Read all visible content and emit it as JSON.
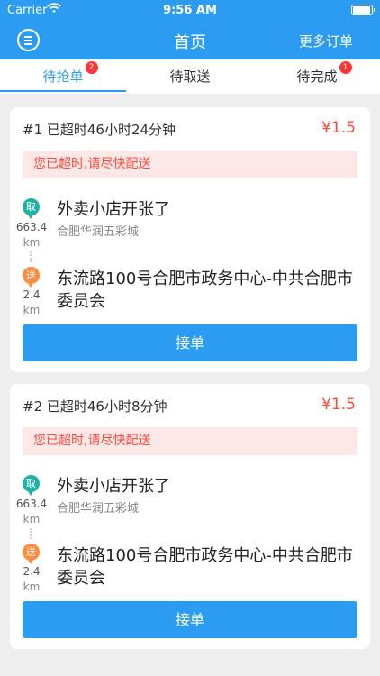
{
  "status_bar": {
    "carrier": "Carrier",
    "time": "9:56 AM"
  },
  "header": {
    "title": "首页",
    "more_orders": "更多订单"
  },
  "tabs": [
    {
      "label": "待抢单",
      "badge": "2",
      "active": true
    },
    {
      "label": "待取送",
      "badge": "",
      "active": false
    },
    {
      "label": "待完成",
      "badge": "1",
      "active": false
    }
  ],
  "orders": [
    {
      "header": "#1 已超时46小时24分钟",
      "price": "¥1.5",
      "alert": "您已超时,请尽快配送",
      "pickup_pin": "取",
      "pickup_distance": "663.4",
      "pickup_unit": "km",
      "shop_name": "外卖小店开张了",
      "shop_address": "合肥华润五彩城",
      "drop_pin": "送",
      "drop_distance": "2.4",
      "drop_unit": "km",
      "destination": "东流路100号合肥市政务中心-中共合肥市委员会",
      "accept": "接单"
    },
    {
      "header": "#2 已超时46小时8分钟",
      "price": "¥1.5",
      "alert": "您已超时,请尽快配送",
      "pickup_pin": "取",
      "pickup_distance": "663.4",
      "pickup_unit": "km",
      "shop_name": "外卖小店开张了",
      "shop_address": "合肥华润五彩城",
      "drop_pin": "送",
      "drop_distance": "2.4",
      "drop_unit": "km",
      "destination": "东流路100号合肥市政务中心-中共合肥市委员会",
      "accept": "接单"
    }
  ],
  "colors": {
    "primary": "#2b9cf2",
    "price": "#ff4a3b",
    "pickup": "#20b1a6",
    "drop": "#ff8a3d",
    "alert_bg": "#fde8e8"
  }
}
